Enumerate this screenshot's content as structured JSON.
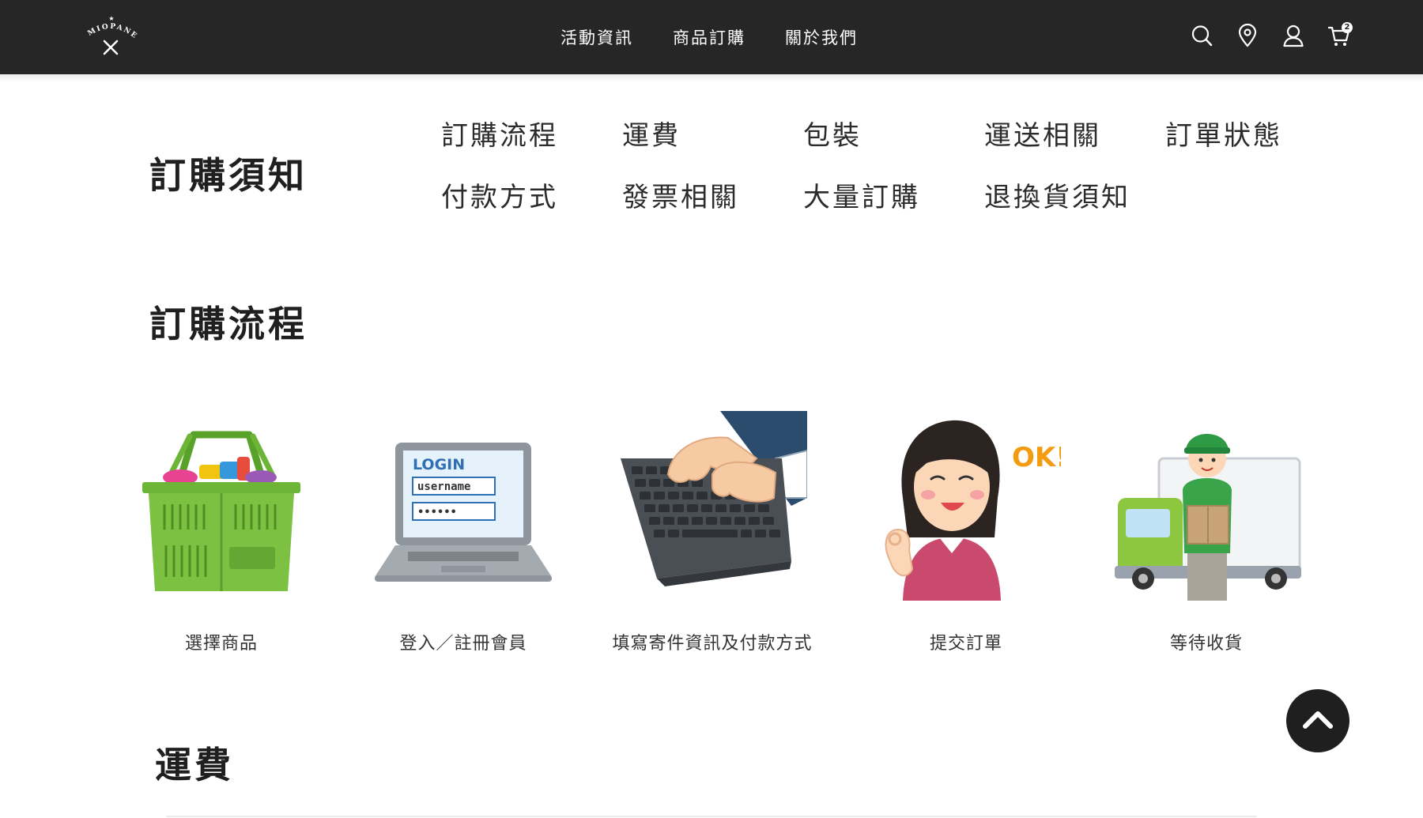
{
  "header": {
    "logo_text": "MIOPANE",
    "nav": [
      "活動資訊",
      "商品訂購",
      "關於我們"
    ],
    "icons": [
      "search-icon",
      "location-icon",
      "user-icon",
      "cart-icon"
    ],
    "cart_count": "2"
  },
  "notice": {
    "title": "訂購須知",
    "links": [
      "訂購流程",
      "運費",
      "包裝",
      "運送相關",
      "訂單狀態",
      "付款方式",
      "發票相關",
      "大量訂購",
      "退換貨須知"
    ]
  },
  "process": {
    "title": "訂購流程",
    "steps": [
      {
        "caption": "選擇商品",
        "icon": "basket-illustration"
      },
      {
        "caption": "登入／註冊會員",
        "icon": "laptop-login-illustration",
        "screen_title": "LOGIN",
        "username_label": "username",
        "password_mask": "••••••"
      },
      {
        "caption": "填寫寄件資訊及付款方式",
        "icon": "keyboard-typing-illustration"
      },
      {
        "caption": "提交訂單",
        "icon": "ok-woman-illustration",
        "ok_text": "OK!"
      },
      {
        "caption": "等待收貨",
        "icon": "delivery-illustration"
      }
    ]
  },
  "shipping": {
    "title": "運費"
  },
  "back_to_top": "chevron-up-icon",
  "colors": {
    "header_bg": "#262626",
    "text": "#222222",
    "basket_green": "#7cc142",
    "delivery_green": "#3aa44a",
    "ok_orange": "#f39c12"
  }
}
